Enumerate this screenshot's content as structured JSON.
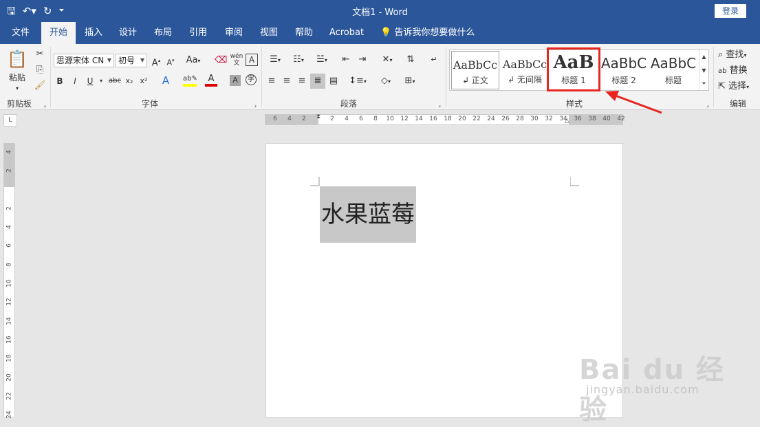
{
  "window": {
    "doc_name": "文档1",
    "separator": "-",
    "app": "Word",
    "login": "登录"
  },
  "tabs": [
    "文件",
    "开始",
    "插入",
    "设计",
    "布局",
    "引用",
    "审阅",
    "视图",
    "帮助",
    "Acrobat"
  ],
  "tell_me": "告诉我你想要做什么",
  "clipboard": {
    "paste": "粘贴",
    "group": "剪贴板"
  },
  "font": {
    "name": "思源宋体 CN",
    "size": "初号",
    "group": "字体",
    "case": "Aa",
    "wen": "wén\n文",
    "bold": "B",
    "italic": "I",
    "underline": "U",
    "strike": "abc",
    "sub": "x₂",
    "sup": "x²",
    "color_a": "A"
  },
  "paragraph": {
    "group": "段落"
  },
  "styles": {
    "group": "样式",
    "items": [
      {
        "sample": "AaBbCc",
        "name": "↲ 正文"
      },
      {
        "sample": "AaBbCc",
        "name": "↲ 无间隔"
      },
      {
        "sample": "AaB",
        "name": "标题 1"
      },
      {
        "sample": "AaBbC",
        "name": "标题 2"
      },
      {
        "sample": "AaBbC",
        "name": "标题"
      }
    ]
  },
  "editing": {
    "find": "查找",
    "replace": "替换",
    "select": "选择",
    "group": "编辑"
  },
  "ruler": {
    "h": [
      "6",
      "4",
      "2",
      "2",
      "4",
      "6",
      "8",
      "10",
      "12",
      "14",
      "16",
      "18",
      "20",
      "22",
      "24",
      "26",
      "28",
      "30",
      "32",
      "34",
      "36",
      "38",
      "40",
      "42"
    ],
    "v": [
      "4",
      "2",
      "2",
      "4",
      "6",
      "8",
      "10",
      "12",
      "14",
      "16",
      "18",
      "20",
      "22",
      "24"
    ],
    "corner": "L"
  },
  "document": {
    "text": "水果蓝莓"
  },
  "watermark": {
    "main": "Bai du 经验",
    "sub": "jingyan.baidu.com"
  },
  "colors": {
    "accent": "#2b579a",
    "highlight_box": "#e8251f"
  }
}
